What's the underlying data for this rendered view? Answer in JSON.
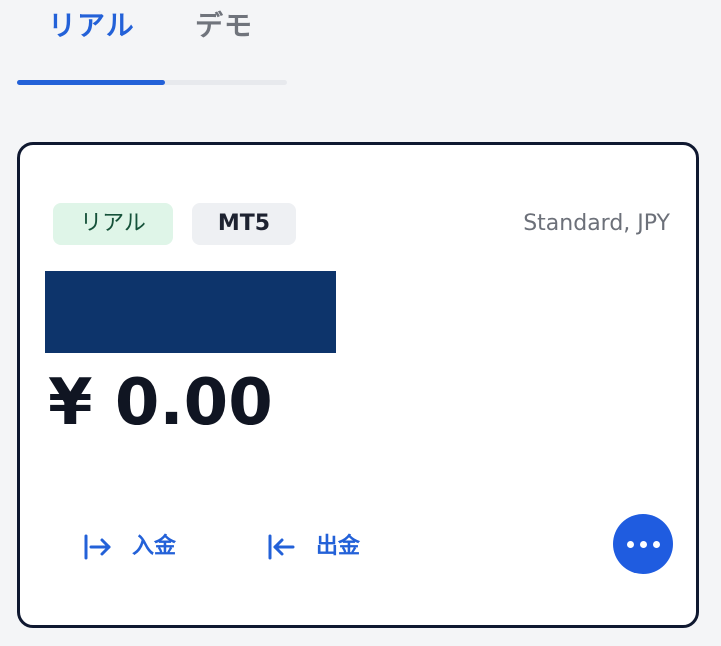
{
  "tabs": {
    "items": [
      {
        "label": "リアル",
        "active": true
      },
      {
        "label": "デモ",
        "active": false
      }
    ],
    "active_color": "#2361d8",
    "inactive_color": "#70747c"
  },
  "account_card": {
    "account_badge": "リアル",
    "platform_badge": "MT5",
    "account_type": "Standard, JPY",
    "balance": "¥ 0.00",
    "actions": {
      "deposit": {
        "label": "入金",
        "icon": "deposit-arrow-icon"
      },
      "withdraw": {
        "label": "出金",
        "icon": "withdraw-arrow-icon"
      },
      "more": {
        "icon": "more-horizontal-icon"
      }
    },
    "colors": {
      "accent": "#2361d8",
      "card_border": "#0f1830",
      "redaction": "#0d346b",
      "real_badge_bg": "#dff5e8",
      "platform_badge_bg": "#eef0f3"
    }
  }
}
